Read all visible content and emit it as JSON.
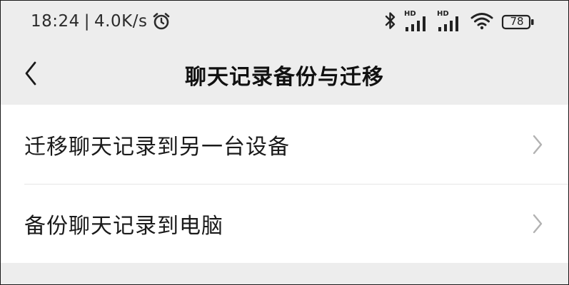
{
  "status_bar": {
    "time": "18:24",
    "separator": "|",
    "network_speed": "4.0K/s",
    "alarm_icon": "alarm-clock-icon",
    "bluetooth_icon": "bluetooth-icon",
    "sim1_label": "HD",
    "sim2_label": "HD",
    "wifi_icon": "wifi-icon",
    "battery_level": "78"
  },
  "nav": {
    "back_icon": "chevron-left-icon",
    "title": "聊天记录备份与迁移"
  },
  "menu": {
    "items": [
      {
        "label": "迁移聊天记录到另一台设备",
        "icon": "chevron-right-icon"
      },
      {
        "label": "备份聊天记录到电脑",
        "icon": "chevron-right-icon"
      }
    ]
  },
  "colors": {
    "background": "#ededed",
    "list_background": "#ffffff",
    "text": "#1a1a1a",
    "chevron": "#b2b2b2"
  }
}
